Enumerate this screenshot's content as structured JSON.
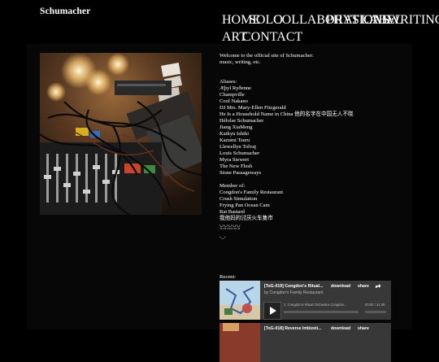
{
  "site": {
    "title": "Schumacher"
  },
  "nav": [
    "HOME",
    "SOLO",
    "COLLABORATIONS",
    "PHYSICAL",
    "LABEL",
    "WRITINGS",
    "ART",
    "CONTACT"
  ],
  "welcome": [
    "Welcome to the official site of Schumacher:",
    "music, writing, etc."
  ],
  "aliases_heading": "Aliases:",
  "aliases": [
    "Æþyl Ryðenne",
    "Champville",
    "Cool Nakano",
    "DJ Mrs. Mary-Ellen Fitzgerald",
    "He Is a Household Name in China 他的名字在中国无人不晓",
    "Hélolse Schumacher",
    "Jiang XiaMeng",
    "Kaikyu Ishiki",
    "Kazumi Tsuru",
    "Llewellyn Tolvaj",
    "Louis Schumacher",
    "Myra Siewert",
    "The New Flesh",
    "Stone Passageways"
  ],
  "member_heading": "Member of:",
  "members": [
    "Congdon's Family Restaurant",
    "Crush Simulation",
    "Frying Pan Ocean Cam",
    "Rat Bastard",
    "我他妈的讨厌火车集市"
  ],
  "symbols": [
    "ꈍꈍꈍꈍꈍ",
    "-_-"
  ],
  "recent_heading": "Recent:",
  "players": [
    {
      "title": "[ToG-019] Congdon's Ritual...",
      "artist": "by Congdon's Family Restaurant",
      "download": "download",
      "share": "share",
      "track": "1. Congdon's Ritual Orchestra Congdon...",
      "time": "00:00 / 31:36"
    },
    {
      "title": "[ToG-018] Reverse Imbizeti...",
      "artist": "",
      "download": "download",
      "share": "share",
      "track": "",
      "time": ""
    }
  ],
  "colors": {
    "background": "#000000",
    "frame": "#070707",
    "player": "#383838",
    "text": "#ffffff"
  }
}
